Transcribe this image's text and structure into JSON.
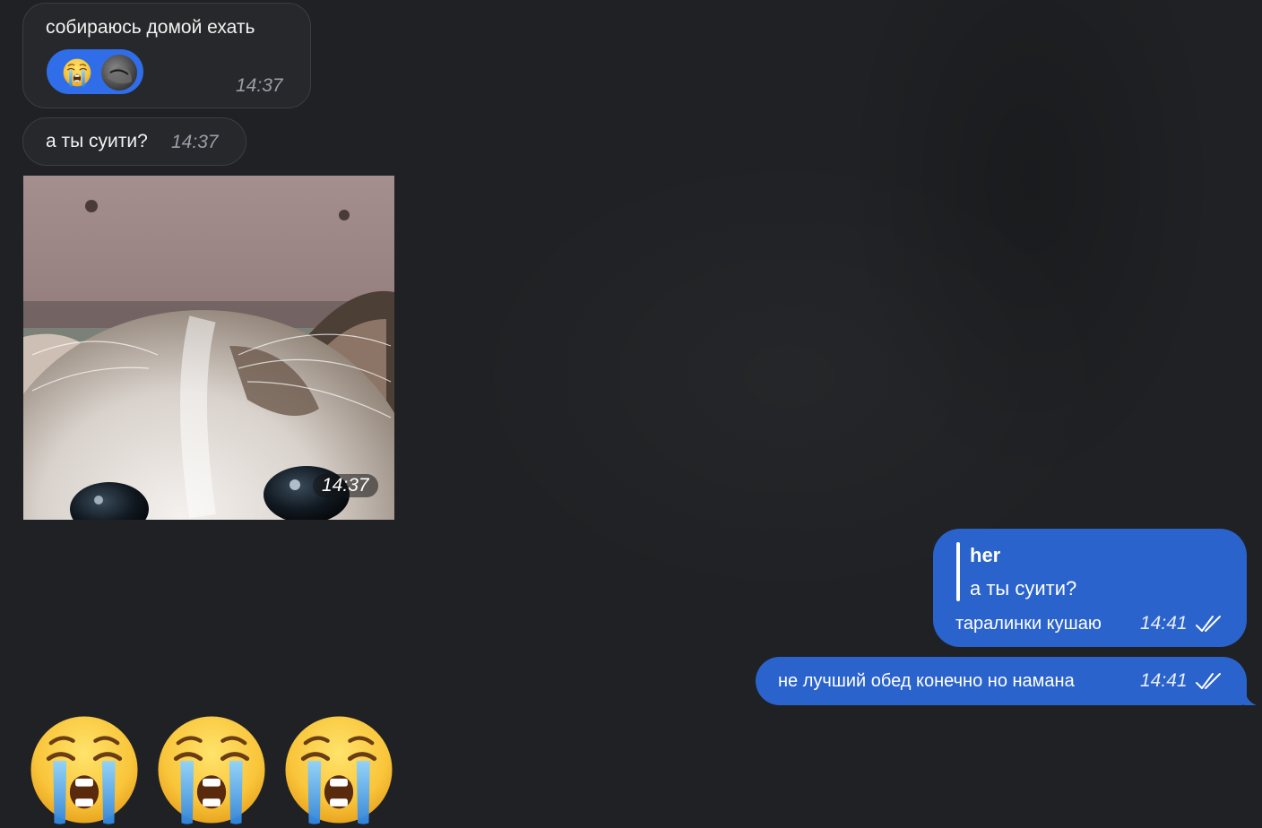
{
  "messages": {
    "m1": {
      "text": "собираюсь домой ехать",
      "time": "14:37",
      "reaction": {
        "emoji": "crying-face",
        "reactor": "avatar"
      }
    },
    "m2": {
      "text": "а ты суити?",
      "time": "14:37"
    },
    "photo": {
      "subject": "kitten",
      "time": "14:37"
    },
    "m3": {
      "quote_author": "her",
      "quote_text": "а ты суити?",
      "text": "таралинки кушаю",
      "time": "14:41",
      "status": "read-double-check"
    },
    "m4": {
      "text": "не лучший обед конечно но намана",
      "time": "14:41",
      "status": "read-double-check"
    },
    "big_emojis": [
      "crying-face",
      "crying-face",
      "crying-face"
    ]
  },
  "colors": {
    "background": "#1f2124",
    "incoming_bubble": "#26282b",
    "outgoing_bubble": "#2a63cc",
    "reaction_pill": "#2f6ee8"
  }
}
